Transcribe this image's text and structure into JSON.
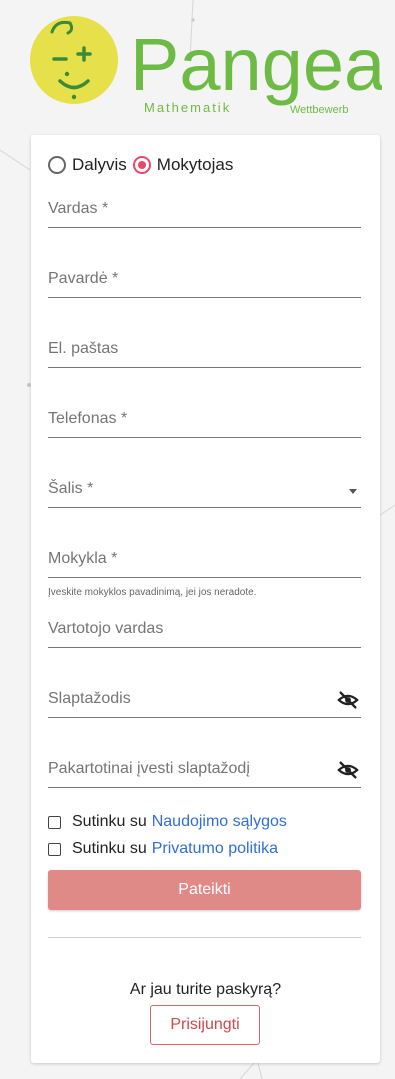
{
  "logo": {
    "name": "Pangea",
    "tagline_left": "Mathematik",
    "tagline_right": "Wettbewerb",
    "face_symbols": "-+",
    "colors": {
      "yellow": "#e6e04a",
      "green": "#6dbb45"
    }
  },
  "form": {
    "roles": [
      {
        "label": "Dalyvis",
        "selected": false
      },
      {
        "label": "Mokytojas",
        "selected": true
      }
    ],
    "fields": {
      "first_name": "Vardas *",
      "last_name": "Pavardė *",
      "email": "El. paštas",
      "phone": "Telefonas *",
      "country": "Šalis *",
      "school": "Mokykla *",
      "school_hint": "Įveskite mokyklos pavadinimą, jei jos neradote.",
      "username": "Vartotojo vardas",
      "password": "Slaptažodis",
      "password_repeat": "Pakartotinai įvesti slaptažodį"
    },
    "terms": {
      "prefix": "Sutinku su",
      "link": "Naudojimo sąlygos",
      "checked": false
    },
    "privacy": {
      "prefix": "Sutinku su",
      "link": "Privatumo politika",
      "checked": false
    },
    "submit_label": "Pateikti",
    "account_question": "Ar jau turite paskyrą?",
    "login_label": "Prisijungti"
  },
  "colors": {
    "accent": "#e8476a",
    "submit_bg": "#e08a87",
    "link": "#2f6fd6",
    "login_border": "#d46a6a"
  }
}
